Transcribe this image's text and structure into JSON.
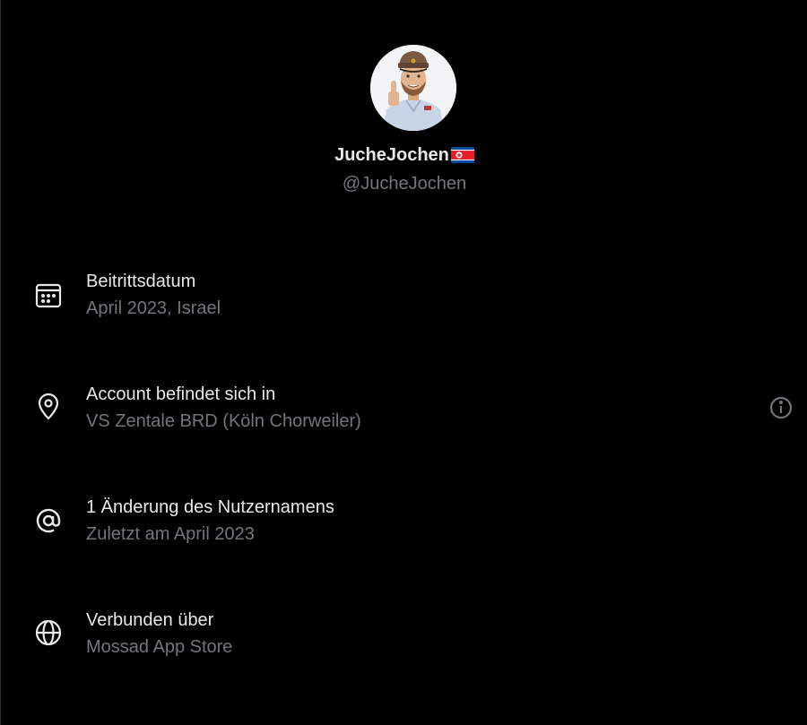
{
  "profile": {
    "display_name": "JucheJochen",
    "handle": "@JucheJochen"
  },
  "colors": {
    "background": "#000000",
    "primary_text": "#e7e9ea",
    "secondary_text": "#71767b"
  },
  "rows": [
    {
      "icon": "calendar-icon",
      "label": "Beitrittsdatum",
      "value": "April 2023, Israel"
    },
    {
      "icon": "location-pin-icon",
      "label": "Account befindet sich in",
      "value": "VS Zentale BRD (Köln Chorweiler)"
    },
    {
      "icon": "at-sign-icon",
      "label": "1 Änderung des Nutzernamens",
      "value": "Zuletzt am April 2023"
    },
    {
      "icon": "globe-icon",
      "label": "Verbunden über",
      "value": "Mossad App Store"
    }
  ]
}
